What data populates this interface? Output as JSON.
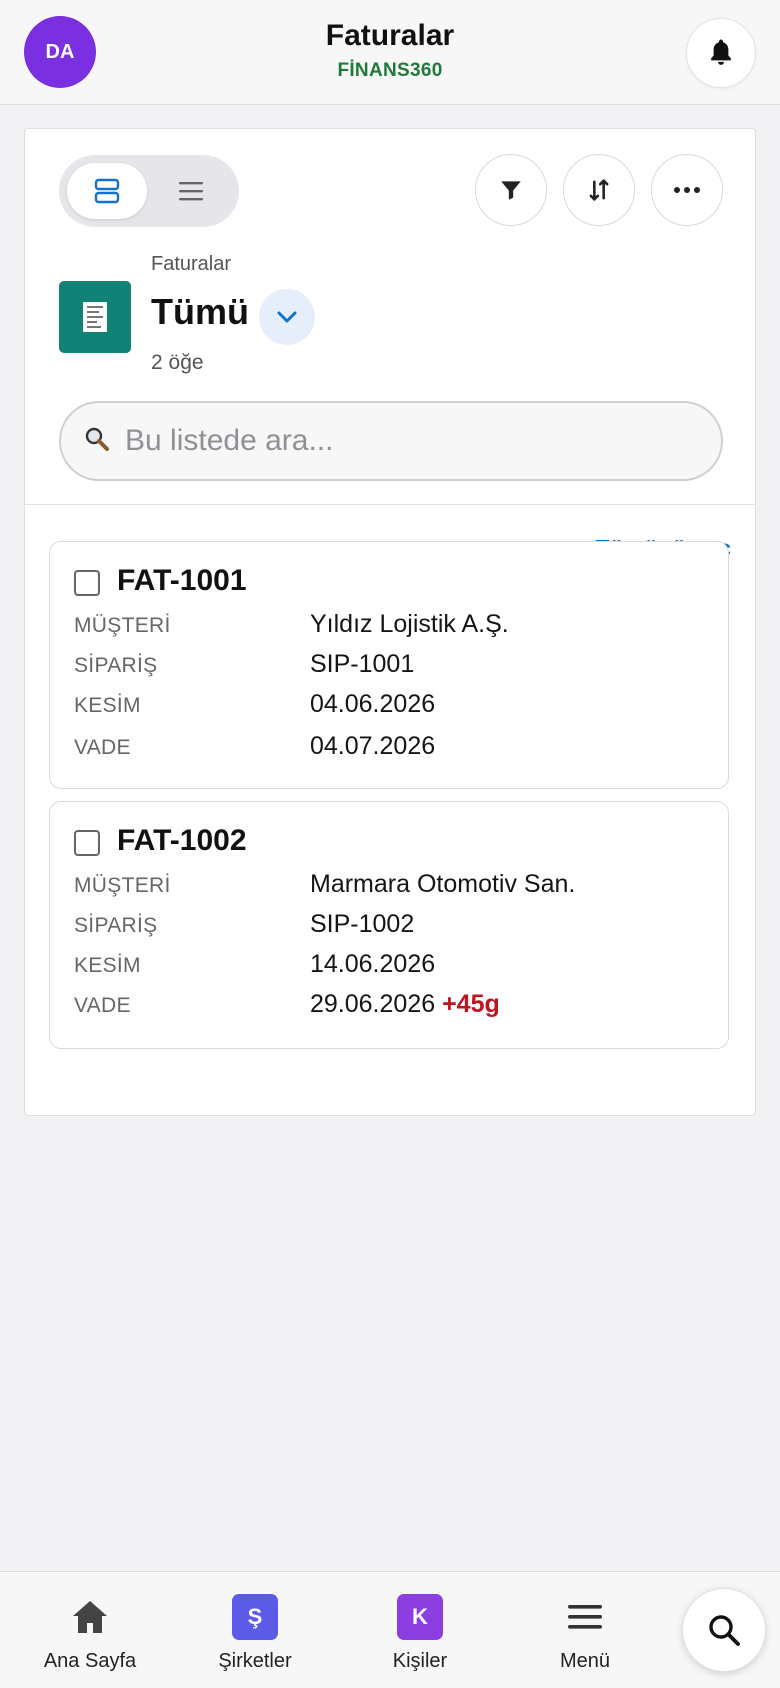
{
  "header": {
    "avatar_initials": "DA",
    "title": "Faturalar",
    "brand": "FİNANS360",
    "brand_color": "#1f7a3a"
  },
  "toolbar": {
    "view_modes": [
      "card-view",
      "list-view"
    ],
    "active_view": "card-view",
    "icons": [
      "filter-icon",
      "sort-icon",
      "more-icon"
    ]
  },
  "list": {
    "object_label": "Faturalar",
    "view_name": "Tümü",
    "count_label": "2 öğe",
    "icon": "receipt-icon",
    "icon_color": "#128277"
  },
  "search": {
    "placeholder": "Bu listede ara...",
    "value": ""
  },
  "select_all_label": "Tümünü seç",
  "items": [
    {
      "id": "FAT-1001",
      "fields": [
        {
          "label": "MÜŞTERİ",
          "value": "Yıldız Lojistik A.Ş."
        },
        {
          "label": "SİPARİŞ",
          "value": "SIP-1001"
        },
        {
          "label": "KESİM",
          "value": "04.06.2026"
        },
        {
          "label": "VADE",
          "value": "04.07.2026"
        }
      ],
      "overdue_badge": ""
    },
    {
      "id": "FAT-1002",
      "fields": [
        {
          "label": "MÜŞTERİ",
          "value": "Marmara Otomotiv San."
        },
        {
          "label": "SİPARİŞ",
          "value": "SIP-1002"
        },
        {
          "label": "KESİM",
          "value": "14.06.2026"
        },
        {
          "label": "VADE",
          "value": "29.06.2026"
        }
      ],
      "overdue_badge": "+45g",
      "overdue_color": "#c1131f"
    }
  ],
  "bottom_nav": [
    {
      "label": "Ana Sayfa",
      "icon": "home-icon"
    },
    {
      "label": "Şirketler",
      "icon": "companies-badge",
      "badge": "Ş",
      "badge_color": "#5b5be8"
    },
    {
      "label": "Kişiler",
      "icon": "contacts-badge",
      "badge": "K",
      "badge_color": "#8b3fe0"
    },
    {
      "label": "Menü",
      "icon": "menu-icon"
    }
  ],
  "accent_color": "#0b74c8"
}
